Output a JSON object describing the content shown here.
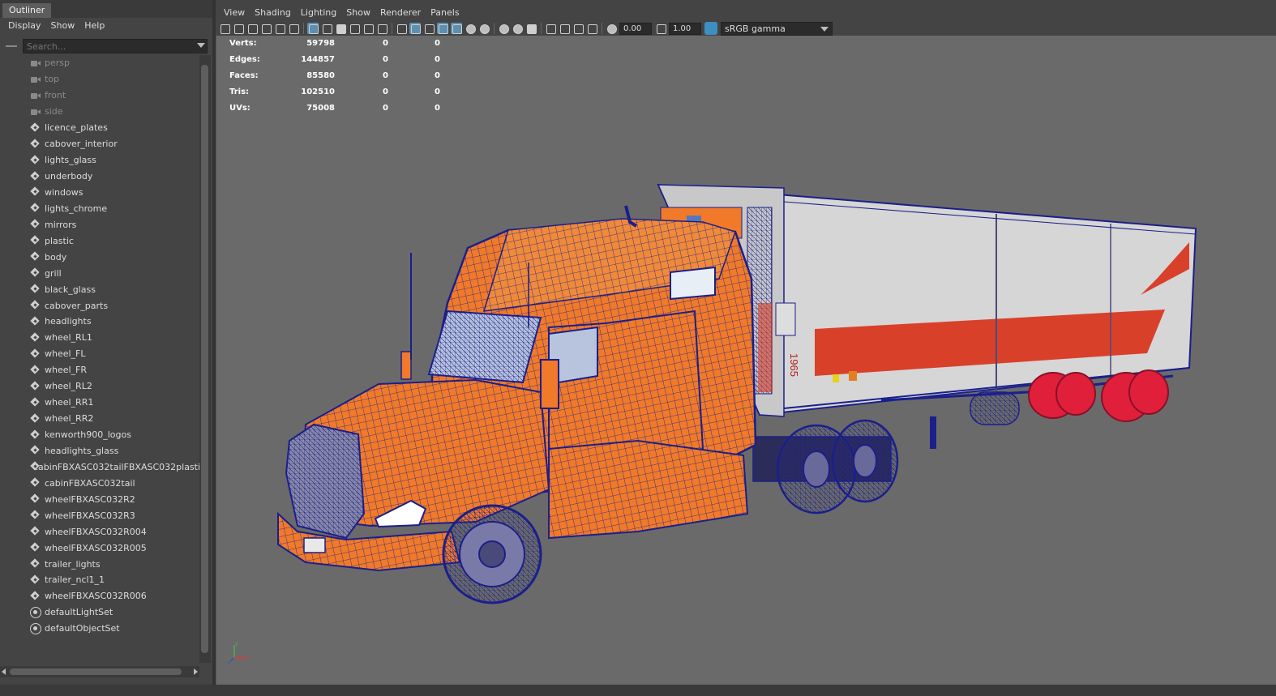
{
  "outliner": {
    "tab": "Outliner",
    "menu": [
      "Display",
      "Show",
      "Help"
    ],
    "search_placeholder": "Search...",
    "items": [
      {
        "label": "persp",
        "icon": "camera-icon"
      },
      {
        "label": "top",
        "icon": "camera-icon"
      },
      {
        "label": "front",
        "icon": "camera-icon"
      },
      {
        "label": "side",
        "icon": "camera-icon"
      },
      {
        "label": "licence_plates",
        "icon": "group-icon"
      },
      {
        "label": "cabover_interior",
        "icon": "group-icon"
      },
      {
        "label": "lights_glass",
        "icon": "group-icon"
      },
      {
        "label": "underbody",
        "icon": "group-icon"
      },
      {
        "label": "windows",
        "icon": "group-icon"
      },
      {
        "label": "lights_chrome",
        "icon": "group-icon"
      },
      {
        "label": "mirrors",
        "icon": "group-icon"
      },
      {
        "label": "plastic",
        "icon": "group-icon"
      },
      {
        "label": "body",
        "icon": "group-icon"
      },
      {
        "label": "grill",
        "icon": "group-icon"
      },
      {
        "label": "black_glass",
        "icon": "group-icon"
      },
      {
        "label": "cabover_parts",
        "icon": "group-icon"
      },
      {
        "label": "headlights",
        "icon": "group-icon"
      },
      {
        "label": "wheel_RL1",
        "icon": "group-icon"
      },
      {
        "label": "wheel_FL",
        "icon": "group-icon"
      },
      {
        "label": "wheel_FR",
        "icon": "group-icon"
      },
      {
        "label": "wheel_RL2",
        "icon": "group-icon"
      },
      {
        "label": "wheel_RR1",
        "icon": "group-icon"
      },
      {
        "label": "wheel_RR2",
        "icon": "group-icon"
      },
      {
        "label": "kenworth900_logos",
        "icon": "group-icon"
      },
      {
        "label": "headlights_glass",
        "icon": "group-icon"
      },
      {
        "label": "cabinFBXASC032tailFBXASC032plastic",
        "icon": "group-icon"
      },
      {
        "label": "cabinFBXASC032tail",
        "icon": "group-icon"
      },
      {
        "label": "wheelFBXASC032R2",
        "icon": "group-icon"
      },
      {
        "label": "wheelFBXASC032R3",
        "icon": "group-icon"
      },
      {
        "label": "wheelFBXASC032R004",
        "icon": "group-icon"
      },
      {
        "label": "wheelFBXASC032R005",
        "icon": "group-icon"
      },
      {
        "label": "trailer_lights",
        "icon": "group-icon"
      },
      {
        "label": "trailer_ncl1_1",
        "icon": "group-icon"
      },
      {
        "label": "wheelFBXASC032R006",
        "icon": "group-icon"
      },
      {
        "label": "defaultLightSet",
        "icon": "set-icon"
      },
      {
        "label": "defaultObjectSet",
        "icon": "set-icon"
      }
    ]
  },
  "viewport": {
    "menu": [
      "View",
      "Shading",
      "Lighting",
      "Show",
      "Renderer",
      "Panels"
    ],
    "exposure": "0.00",
    "gamma": "1.00",
    "color_space": "sRGB gamma",
    "hud": [
      {
        "label": "Verts:",
        "v1": "59798",
        "v2": "0",
        "v3": "0"
      },
      {
        "label": "Edges:",
        "v1": "144857",
        "v2": "0",
        "v3": "0"
      },
      {
        "label": "Faces:",
        "v1": "85580",
        "v2": "0",
        "v3": "0"
      },
      {
        "label": "Tris:",
        "v1": "102510",
        "v2": "0",
        "v3": "0"
      },
      {
        "label": "UVs:",
        "v1": "75008",
        "v2": "0",
        "v3": "0"
      }
    ],
    "trailer_number": "1965",
    "colors": {
      "cab_orange": "#f07a2a",
      "wire_blue": "#1b1f8a",
      "trailer_white": "#d9d9d9",
      "stripe_red": "#d9402a",
      "rear_wheels_red": "#e0203a"
    }
  }
}
